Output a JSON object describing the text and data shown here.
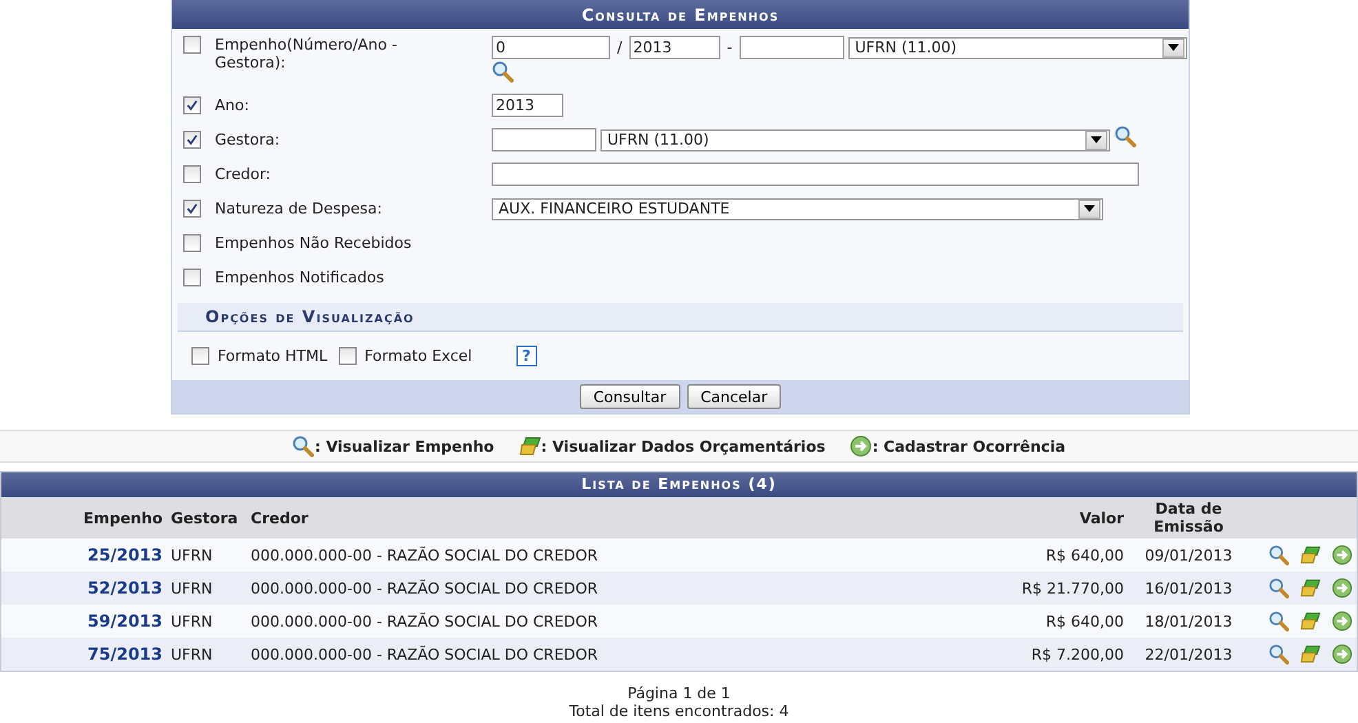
{
  "form": {
    "title": "Consulta de Empenhos",
    "filters": [
      {
        "kind": "empenho",
        "label": "Empenho(Número/Ano - Gestora):",
        "checked": false,
        "numero": "0",
        "slash": "/",
        "ano": "2013",
        "dash": "-",
        "select": "UFRN (11.00)"
      },
      {
        "kind": "short",
        "label": "Ano:",
        "checked": true,
        "value": "2013"
      },
      {
        "kind": "gestora",
        "label": "Gestora:",
        "checked": true,
        "select": "UFRN (11.00)"
      },
      {
        "kind": "text",
        "label": "Credor:",
        "checked": false
      },
      {
        "kind": "select",
        "label": "Natureza de Despesa:",
        "checked": true,
        "select": "AUX. FINANCEIRO ESTUDANTE"
      },
      {
        "kind": "none",
        "label": "Empenhos Não Recebidos",
        "checked": false
      },
      {
        "kind": "none",
        "label": "Empenhos Notificados",
        "checked": false
      }
    ],
    "options_title": "Opções de Visualização",
    "formats": [
      {
        "label": "Formato HTML",
        "checked": false
      },
      {
        "label": "Formato Excel",
        "checked": false
      }
    ],
    "help": "?",
    "buttons": [
      "Consultar",
      "Cancelar"
    ]
  },
  "legend": [
    {
      "kind": "view",
      "label": ": Visualizar Empenho"
    },
    {
      "kind": "budget",
      "label": ": Visualizar Dados Orçamentários"
    },
    {
      "kind": "occurrence",
      "label": ": Cadastrar Ocorrência"
    }
  ],
  "table": {
    "title": "Lista de Empenhos (4)",
    "columns": [
      "Empenho",
      "Gestora",
      "Credor",
      "Valor",
      "Data de Emissão"
    ],
    "rows": [
      {
        "empenho": "25/2013",
        "gestora": "UFRN",
        "credor": "000.000.000-00 - RAZÃO SOCIAL DO CREDOR",
        "valor": "R$ 640,00",
        "data": "09/01/2013"
      },
      {
        "empenho": "52/2013",
        "gestora": "UFRN",
        "credor": "000.000.000-00 - RAZÃO SOCIAL DO CREDOR",
        "valor": "R$ 21.770,00",
        "data": "16/01/2013"
      },
      {
        "empenho": "59/2013",
        "gestora": "UFRN",
        "credor": "000.000.000-00 - RAZÃO SOCIAL DO CREDOR",
        "valor": "R$ 640,00",
        "data": "18/01/2013"
      },
      {
        "empenho": "75/2013",
        "gestora": "UFRN",
        "credor": "000.000.000-00 - RAZÃO SOCIAL DO CREDOR",
        "valor": "R$ 7.200,00",
        "data": "22/01/2013"
      }
    ]
  },
  "pagination": {
    "page": "Página 1 de 1",
    "total": "Total de itens encontrados: 4"
  }
}
